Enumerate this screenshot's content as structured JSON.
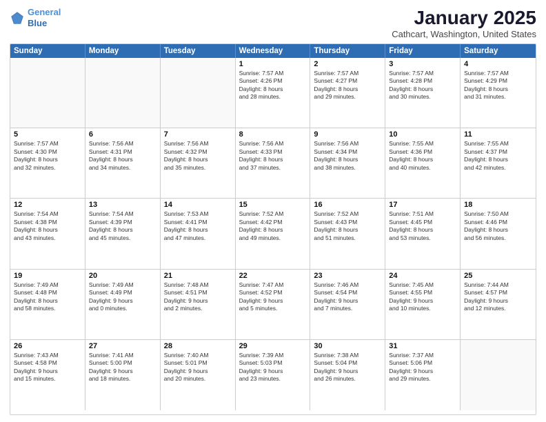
{
  "header": {
    "logo_line1": "General",
    "logo_line2": "Blue",
    "month_title": "January 2025",
    "location": "Cathcart, Washington, United States"
  },
  "days_of_week": [
    "Sunday",
    "Monday",
    "Tuesday",
    "Wednesday",
    "Thursday",
    "Friday",
    "Saturday"
  ],
  "weeks": [
    [
      {
        "day": "",
        "text": ""
      },
      {
        "day": "",
        "text": ""
      },
      {
        "day": "",
        "text": ""
      },
      {
        "day": "1",
        "text": "Sunrise: 7:57 AM\nSunset: 4:26 PM\nDaylight: 8 hours\nand 28 minutes."
      },
      {
        "day": "2",
        "text": "Sunrise: 7:57 AM\nSunset: 4:27 PM\nDaylight: 8 hours\nand 29 minutes."
      },
      {
        "day": "3",
        "text": "Sunrise: 7:57 AM\nSunset: 4:28 PM\nDaylight: 8 hours\nand 30 minutes."
      },
      {
        "day": "4",
        "text": "Sunrise: 7:57 AM\nSunset: 4:29 PM\nDaylight: 8 hours\nand 31 minutes."
      }
    ],
    [
      {
        "day": "5",
        "text": "Sunrise: 7:57 AM\nSunset: 4:30 PM\nDaylight: 8 hours\nand 32 minutes."
      },
      {
        "day": "6",
        "text": "Sunrise: 7:56 AM\nSunset: 4:31 PM\nDaylight: 8 hours\nand 34 minutes."
      },
      {
        "day": "7",
        "text": "Sunrise: 7:56 AM\nSunset: 4:32 PM\nDaylight: 8 hours\nand 35 minutes."
      },
      {
        "day": "8",
        "text": "Sunrise: 7:56 AM\nSunset: 4:33 PM\nDaylight: 8 hours\nand 37 minutes."
      },
      {
        "day": "9",
        "text": "Sunrise: 7:56 AM\nSunset: 4:34 PM\nDaylight: 8 hours\nand 38 minutes."
      },
      {
        "day": "10",
        "text": "Sunrise: 7:55 AM\nSunset: 4:36 PM\nDaylight: 8 hours\nand 40 minutes."
      },
      {
        "day": "11",
        "text": "Sunrise: 7:55 AM\nSunset: 4:37 PM\nDaylight: 8 hours\nand 42 minutes."
      }
    ],
    [
      {
        "day": "12",
        "text": "Sunrise: 7:54 AM\nSunset: 4:38 PM\nDaylight: 8 hours\nand 43 minutes."
      },
      {
        "day": "13",
        "text": "Sunrise: 7:54 AM\nSunset: 4:39 PM\nDaylight: 8 hours\nand 45 minutes."
      },
      {
        "day": "14",
        "text": "Sunrise: 7:53 AM\nSunset: 4:41 PM\nDaylight: 8 hours\nand 47 minutes."
      },
      {
        "day": "15",
        "text": "Sunrise: 7:52 AM\nSunset: 4:42 PM\nDaylight: 8 hours\nand 49 minutes."
      },
      {
        "day": "16",
        "text": "Sunrise: 7:52 AM\nSunset: 4:43 PM\nDaylight: 8 hours\nand 51 minutes."
      },
      {
        "day": "17",
        "text": "Sunrise: 7:51 AM\nSunset: 4:45 PM\nDaylight: 8 hours\nand 53 minutes."
      },
      {
        "day": "18",
        "text": "Sunrise: 7:50 AM\nSunset: 4:46 PM\nDaylight: 8 hours\nand 56 minutes."
      }
    ],
    [
      {
        "day": "19",
        "text": "Sunrise: 7:49 AM\nSunset: 4:48 PM\nDaylight: 8 hours\nand 58 minutes."
      },
      {
        "day": "20",
        "text": "Sunrise: 7:49 AM\nSunset: 4:49 PM\nDaylight: 9 hours\nand 0 minutes."
      },
      {
        "day": "21",
        "text": "Sunrise: 7:48 AM\nSunset: 4:51 PM\nDaylight: 9 hours\nand 2 minutes."
      },
      {
        "day": "22",
        "text": "Sunrise: 7:47 AM\nSunset: 4:52 PM\nDaylight: 9 hours\nand 5 minutes."
      },
      {
        "day": "23",
        "text": "Sunrise: 7:46 AM\nSunset: 4:54 PM\nDaylight: 9 hours\nand 7 minutes."
      },
      {
        "day": "24",
        "text": "Sunrise: 7:45 AM\nSunset: 4:55 PM\nDaylight: 9 hours\nand 10 minutes."
      },
      {
        "day": "25",
        "text": "Sunrise: 7:44 AM\nSunset: 4:57 PM\nDaylight: 9 hours\nand 12 minutes."
      }
    ],
    [
      {
        "day": "26",
        "text": "Sunrise: 7:43 AM\nSunset: 4:58 PM\nDaylight: 9 hours\nand 15 minutes."
      },
      {
        "day": "27",
        "text": "Sunrise: 7:41 AM\nSunset: 5:00 PM\nDaylight: 9 hours\nand 18 minutes."
      },
      {
        "day": "28",
        "text": "Sunrise: 7:40 AM\nSunset: 5:01 PM\nDaylight: 9 hours\nand 20 minutes."
      },
      {
        "day": "29",
        "text": "Sunrise: 7:39 AM\nSunset: 5:03 PM\nDaylight: 9 hours\nand 23 minutes."
      },
      {
        "day": "30",
        "text": "Sunrise: 7:38 AM\nSunset: 5:04 PM\nDaylight: 9 hours\nand 26 minutes."
      },
      {
        "day": "31",
        "text": "Sunrise: 7:37 AM\nSunset: 5:06 PM\nDaylight: 9 hours\nand 29 minutes."
      },
      {
        "day": "",
        "text": ""
      }
    ]
  ]
}
